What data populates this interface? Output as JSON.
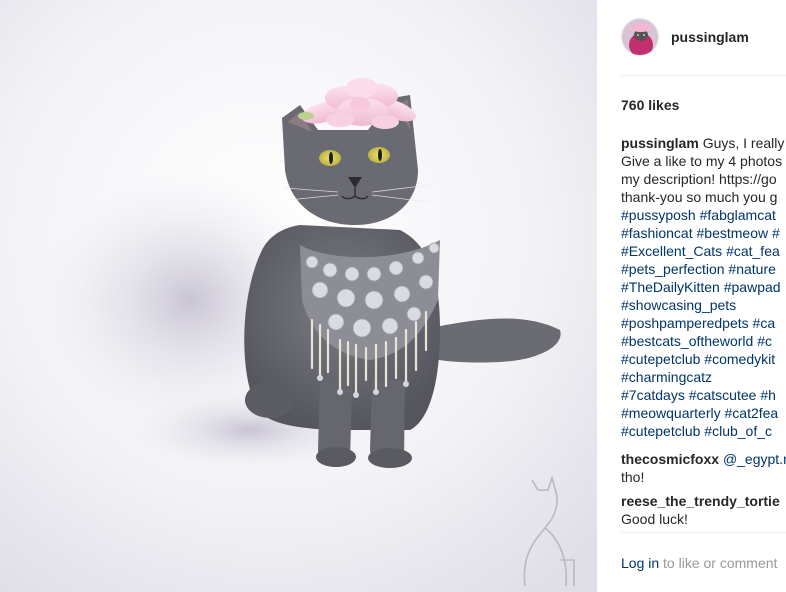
{
  "post": {
    "username": "pussinglam",
    "likes": "760 likes",
    "caption": {
      "username": "pussinglam",
      "lines": [
        [
          {
            "text": "Guys, I really",
            "tag": false
          }
        ],
        [
          {
            "text": "Give a like to my 4 photos",
            "tag": false
          }
        ],
        [
          {
            "text": "my description! https://go",
            "tag": false
          }
        ],
        [
          {
            "text": "thank-you so much you g",
            "tag": false
          }
        ],
        [
          {
            "text": "#pussyposh",
            "tag": true
          },
          {
            "text": " ",
            "tag": false
          },
          {
            "text": "#fabglamcat",
            "tag": true
          }
        ],
        [
          {
            "text": "#fashioncat",
            "tag": true
          },
          {
            "text": " ",
            "tag": false
          },
          {
            "text": "#bestmeow",
            "tag": true
          },
          {
            "text": " ",
            "tag": false
          },
          {
            "text": "#",
            "tag": true
          }
        ],
        [
          {
            "text": "#Excellent_Cats",
            "tag": true
          },
          {
            "text": " ",
            "tag": false
          },
          {
            "text": "#cat_fea",
            "tag": true
          }
        ],
        [
          {
            "text": "#pets_perfection",
            "tag": true
          },
          {
            "text": " ",
            "tag": false
          },
          {
            "text": "#nature",
            "tag": true
          }
        ],
        [
          {
            "text": "#TheDailyKitten",
            "tag": true
          },
          {
            "text": " ",
            "tag": false
          },
          {
            "text": "#pawpad",
            "tag": true
          }
        ],
        [
          {
            "text": "#showcasing_pets",
            "tag": true
          }
        ],
        [
          {
            "text": "#poshpamperedpets",
            "tag": true
          },
          {
            "text": " ",
            "tag": false
          },
          {
            "text": "#ca",
            "tag": true
          }
        ],
        [
          {
            "text": "#bestcats_oftheworld",
            "tag": true
          },
          {
            "text": " ",
            "tag": false
          },
          {
            "text": "#c",
            "tag": true
          }
        ],
        [
          {
            "text": "#cutepetclub",
            "tag": true
          },
          {
            "text": " ",
            "tag": false
          },
          {
            "text": "#comedykit",
            "tag": true
          }
        ],
        [
          {
            "text": "#charmingcatz",
            "tag": true
          }
        ],
        [
          {
            "text": "#7catdays",
            "tag": true
          },
          {
            "text": " ",
            "tag": false
          },
          {
            "text": "#catscutee",
            "tag": true
          },
          {
            "text": " ",
            "tag": false
          },
          {
            "text": "#h",
            "tag": true
          }
        ],
        [
          {
            "text": "#meowquarterly",
            "tag": true
          },
          {
            "text": " ",
            "tag": false
          },
          {
            "text": "#cat2fea",
            "tag": true
          }
        ],
        [
          {
            "text": "#cutepetclub",
            "tag": true
          },
          {
            "text": " ",
            "tag": false
          },
          {
            "text": "#club_of_c",
            "tag": true
          }
        ]
      ]
    },
    "comments": [
      {
        "username": "thecosmicfoxx",
        "mention": "@_egypt.n",
        "text_line2": "tho!"
      },
      {
        "username": "reese_the_trendy_tortie",
        "text_line2": "Good luck!"
      }
    ],
    "login": {
      "link": "Log in",
      "rest": " to like or comment"
    }
  }
}
